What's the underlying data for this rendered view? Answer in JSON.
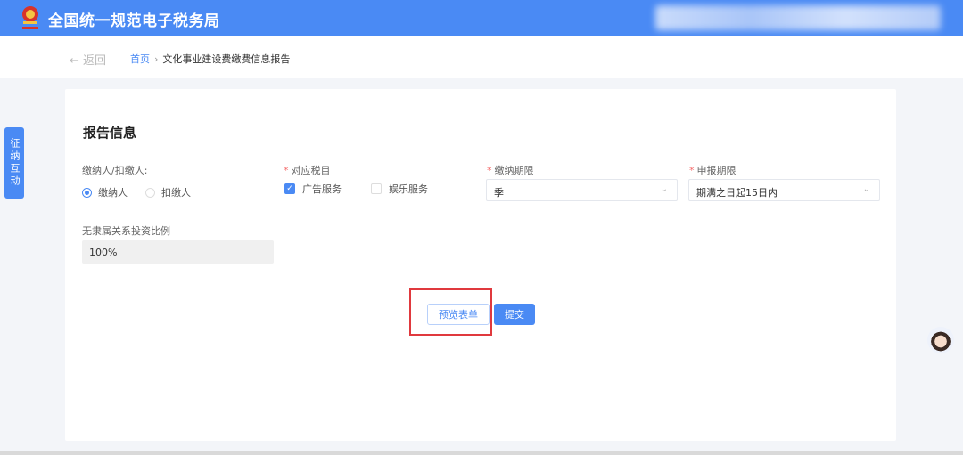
{
  "header": {
    "title": "全国统一规范电子税务局",
    "brand_color": "#4a8af4",
    "logo_icon": "national-emblem-icon"
  },
  "breadcrumb": {
    "back_label": "← 返回",
    "home": "首页",
    "separator": "›",
    "current": "文化事业建设费缴费信息报告"
  },
  "form": {
    "section_title": "报告信息",
    "payer": {
      "label": "缴纳人/扣缴人:",
      "options": [
        "缴纳人",
        "扣缴人"
      ],
      "selected": "缴纳人"
    },
    "tax_item": {
      "label": "对应税目",
      "required": "*",
      "options": [
        {
          "label": "广告服务",
          "checked": true
        },
        {
          "label": "娱乐服务",
          "checked": false
        }
      ]
    },
    "payment_period": {
      "label": "缴纳期限",
      "required": "*",
      "value": "季"
    },
    "filing_period": {
      "label": "申报期限",
      "required": "*",
      "value": "期满之日起15日内"
    },
    "ratio": {
      "label": "无隶属关系投资比例",
      "value": "100%"
    }
  },
  "actions": {
    "preview": "预览表单",
    "submit": "提交",
    "highlight_color": "#e0393e"
  },
  "side_tab": {
    "label": "征纳互动"
  },
  "assistant": {
    "icon": "assistant-avatar-icon"
  }
}
